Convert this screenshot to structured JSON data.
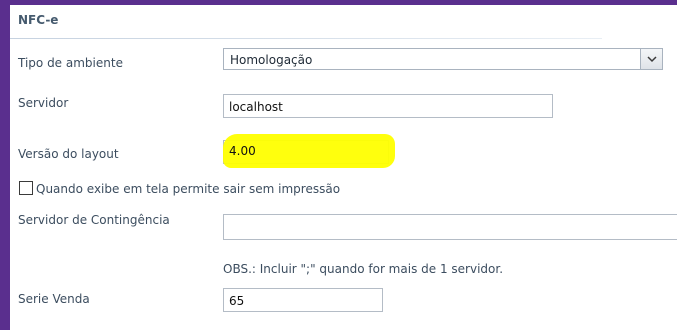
{
  "section": {
    "title": "NFC-e"
  },
  "fields": {
    "ambiente": {
      "label": "Tipo de ambiente",
      "value": "Homologação"
    },
    "servidor": {
      "label": "Servidor",
      "value": "localhost"
    },
    "versao": {
      "label": "Versão do layout",
      "value": "4.00"
    },
    "permite_sair": {
      "label": "Quando exibe em tela permite sair sem impressão",
      "checked": false
    },
    "contingencia": {
      "label": "Servidor de Contingência",
      "value": "",
      "note": "OBS.: Incluir \";\" quando for mais de 1 servidor."
    },
    "serie_venda": {
      "label": "Serie Venda",
      "value": "65"
    }
  },
  "colors": {
    "frame": "#5a2f8e",
    "highlight": "#ffff00",
    "label": "#3c4d5f"
  },
  "icons": {
    "dropdown": "chevron-down-icon"
  }
}
